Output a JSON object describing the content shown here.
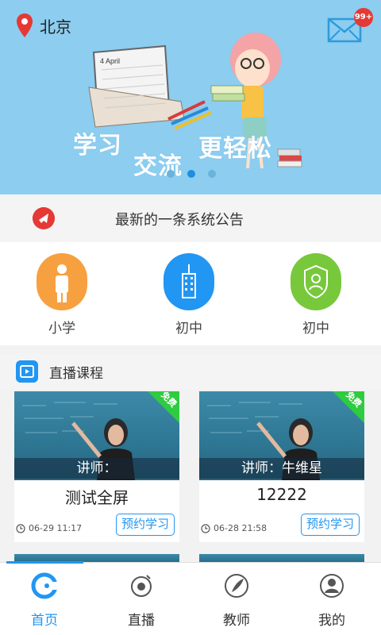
{
  "location": {
    "city": "北京"
  },
  "mail": {
    "badge": "99+"
  },
  "banner": {
    "slogans": [
      "学习",
      "交流",
      "更轻松"
    ],
    "calendar_month": "4 April",
    "slide_count": 3,
    "active_slide": 1
  },
  "notice": {
    "text": "最新的一条系统公告"
  },
  "categories": [
    {
      "label": "小学",
      "color": "#f7a040",
      "icon": "schoolbag-child-icon"
    },
    {
      "label": "初中",
      "color": "#2196f3",
      "icon": "building-icon"
    },
    {
      "label": "初中",
      "color": "#78c83c",
      "icon": "shield-person-icon"
    }
  ],
  "section": {
    "title": "直播课程"
  },
  "courses": [
    {
      "lecturer": "讲师：",
      "title": "测试全屏",
      "time": "06-29 11:17",
      "action": "预约学习",
      "tag": "免费"
    },
    {
      "lecturer": "讲师：牛维星",
      "title": "12222",
      "time": "06-28 21:58",
      "action": "预约学习",
      "tag": "免费"
    }
  ],
  "tabs": [
    {
      "label": "首页",
      "active": true
    },
    {
      "label": "直播",
      "active": false
    },
    {
      "label": "教师",
      "active": false
    },
    {
      "label": "我的",
      "active": false
    }
  ],
  "colors": {
    "accent": "#2196f3",
    "banner": "#8ccdf0",
    "free_tag": "#2ecc40",
    "badge": "#e53935"
  }
}
